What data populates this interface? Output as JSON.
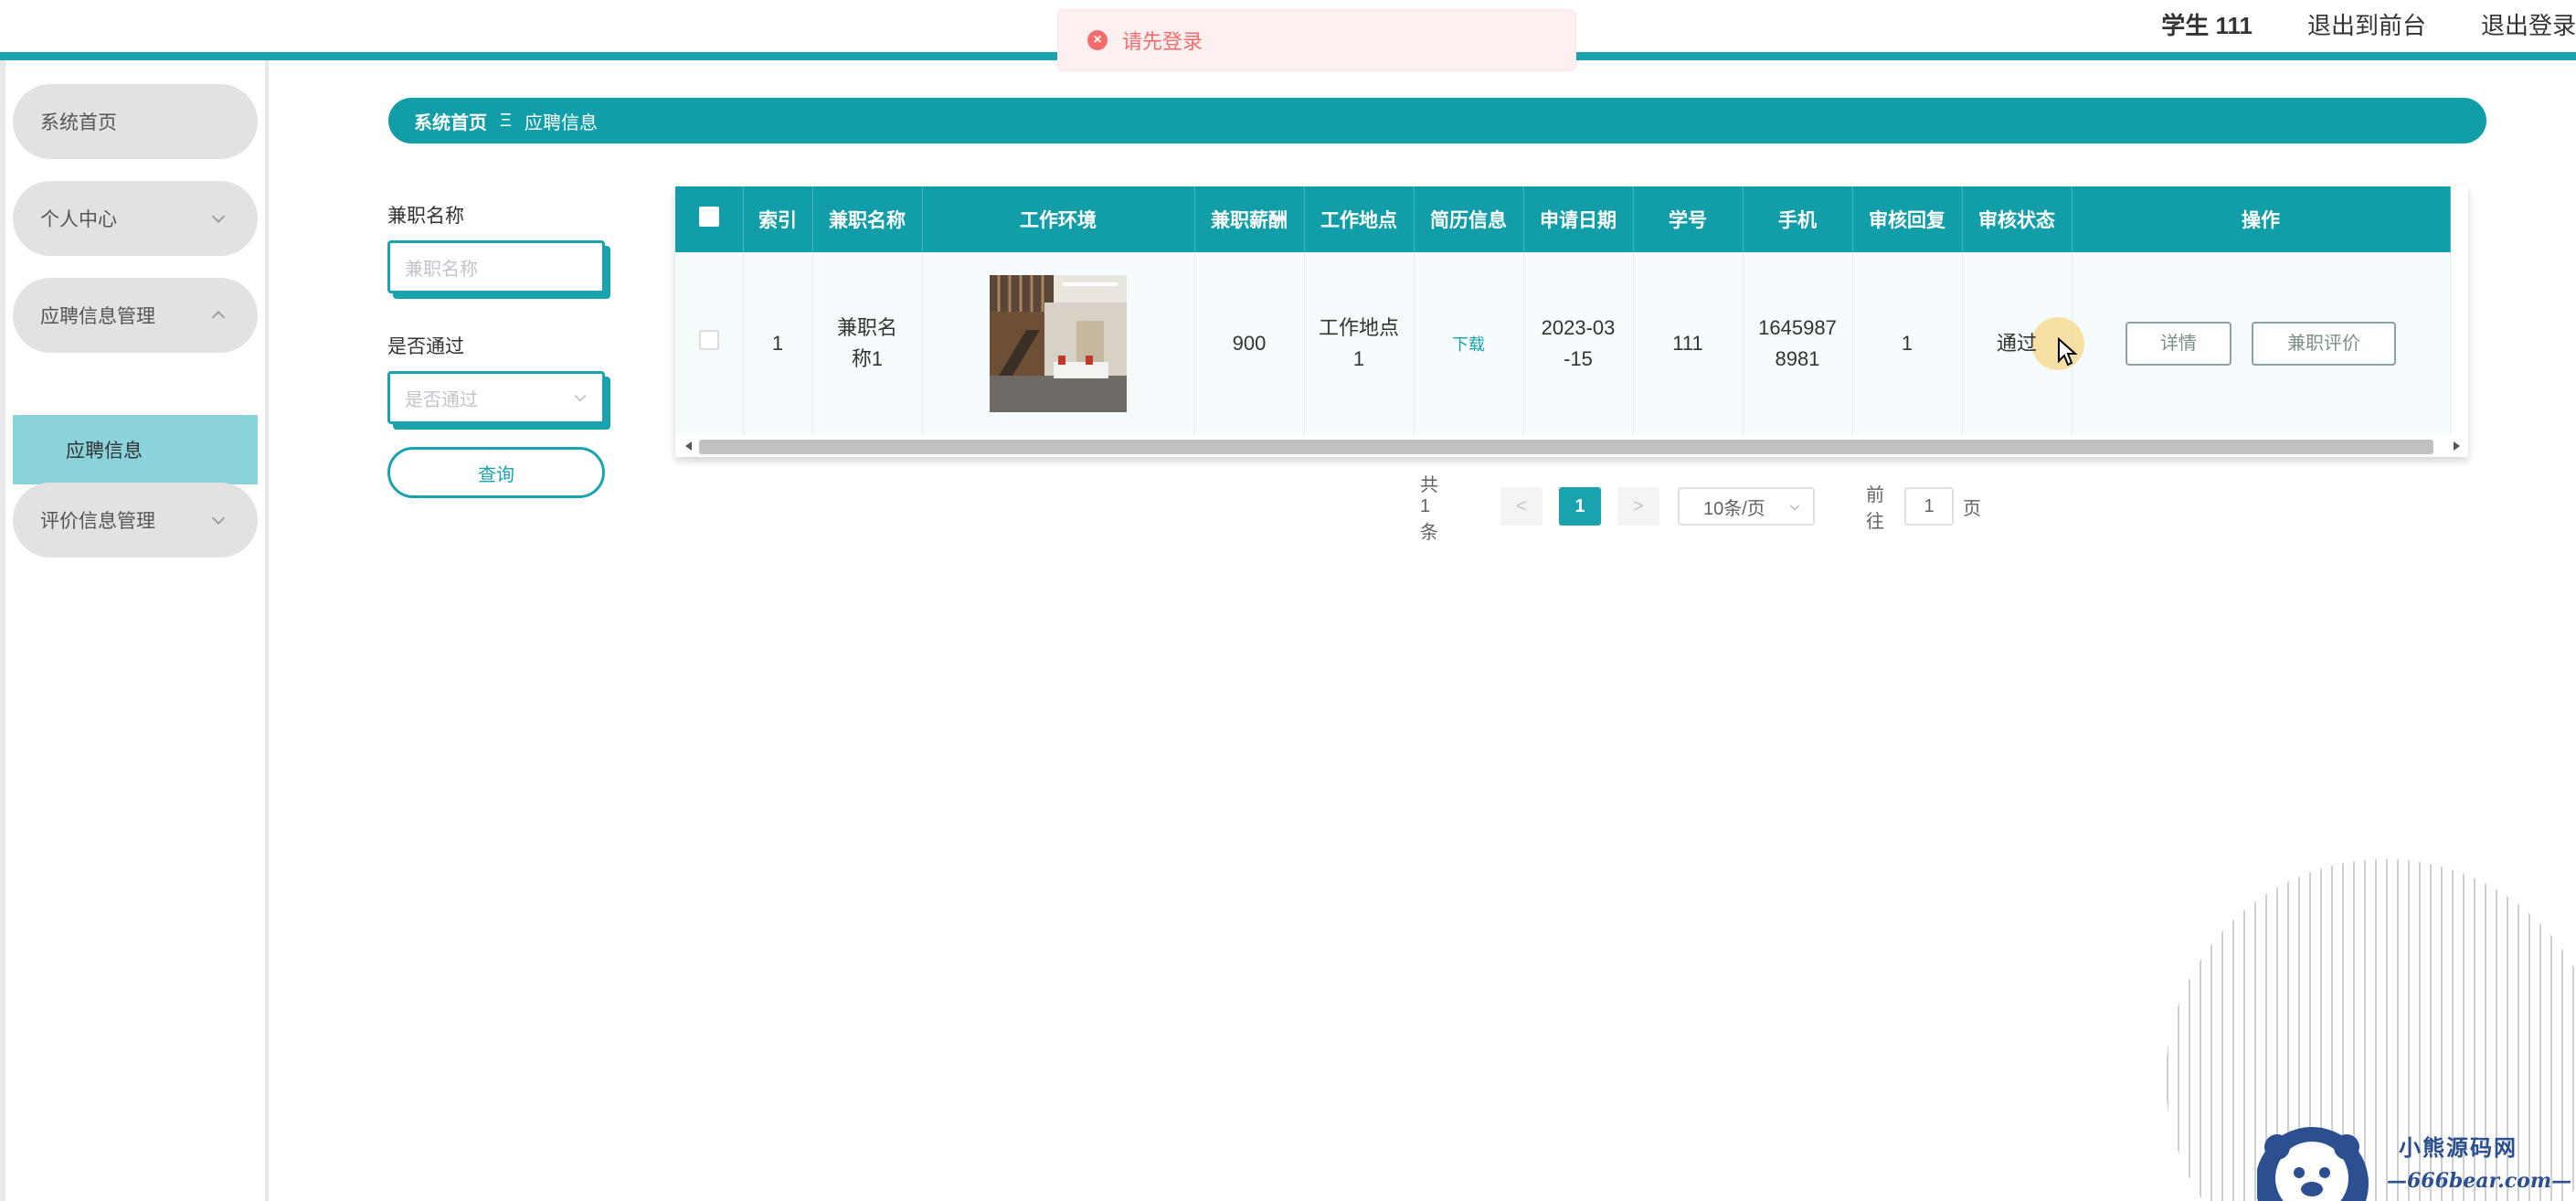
{
  "header": {
    "user": "学生 111",
    "back_to_front": "退出到前台",
    "logout": "退出登录"
  },
  "toast": {
    "message": "请先登录",
    "type": "error"
  },
  "sidebar": {
    "items": [
      {
        "label": "系统首页",
        "has_chevron": false
      },
      {
        "label": "个人中心",
        "has_chevron": true,
        "expanded": false
      },
      {
        "label": "应聘信息管理",
        "has_chevron": true,
        "expanded": true
      },
      {
        "label": "评价信息管理",
        "has_chevron": true,
        "expanded": false
      }
    ],
    "sub_items": [
      {
        "label": "应聘信息",
        "active": true
      }
    ]
  },
  "breadcrumb": {
    "home": "系统首页",
    "separator": "Ξ",
    "current": "应聘信息"
  },
  "search": {
    "job_name_label": "兼职名称",
    "job_name_placeholder": "兼职名称",
    "passed_label": "是否通过",
    "passed_placeholder": "是否通过",
    "query_button": "查询"
  },
  "table": {
    "headers": [
      "索引",
      "兼职名称",
      "工作环境",
      "兼职薪酬",
      "工作地点",
      "简历信息",
      "申请日期",
      "学号",
      "手机",
      "审核回复",
      "审核状态",
      "操作"
    ],
    "rows": [
      {
        "index": "1",
        "job_name": "兼职名称1",
        "salary": "900",
        "location": "工作地点1",
        "resume": "下载",
        "date": "2023-03-15",
        "student_id": "111",
        "phone": "16459878981",
        "reply": "1",
        "status": "通过",
        "detail_button": "详情",
        "review_button": "兼职评价"
      }
    ]
  },
  "pagination": {
    "total": "共 1 条",
    "prev": "<",
    "current": "1",
    "next": ">",
    "page_size": "10条/页",
    "goto_prefix": "前往",
    "goto_value": "1",
    "goto_suffix": "页"
  },
  "watermark": {
    "brand": "小熊源码网",
    "url": "—666bear.com—"
  },
  "colors": {
    "accent": "#129ea9",
    "error": "#f56c6c",
    "sidebar_active": "#8ad3da"
  }
}
